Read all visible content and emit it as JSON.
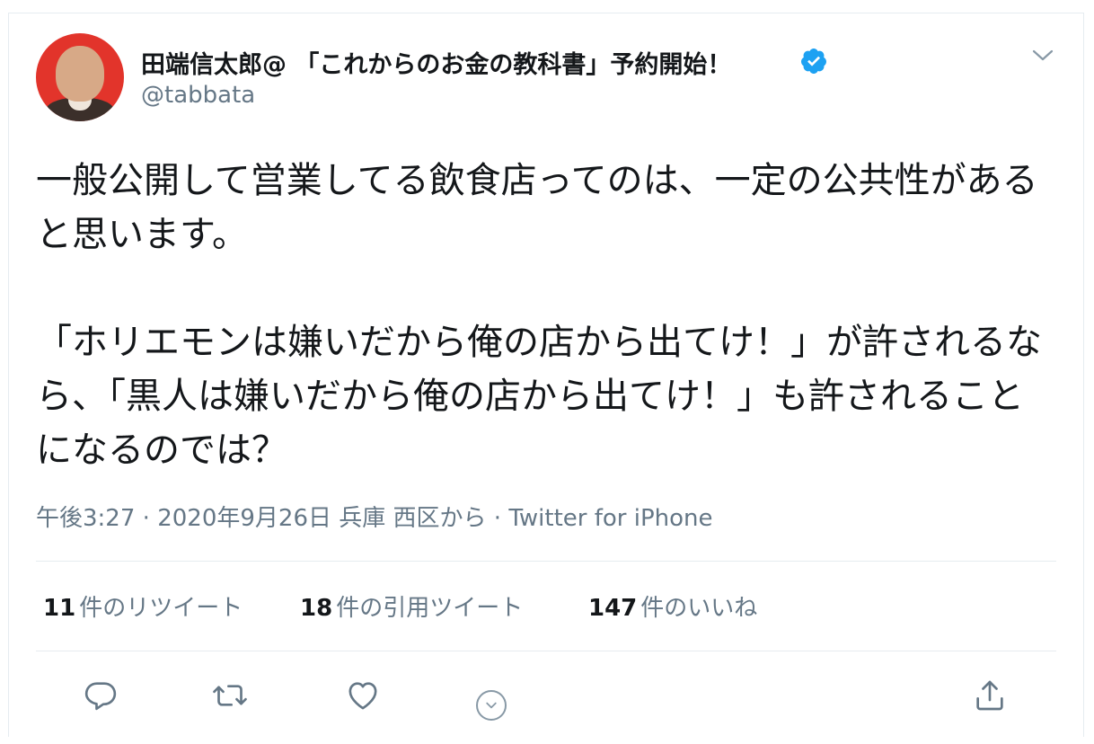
{
  "tweet": {
    "display_name": "田端信太郎@ 「これからのお金の教科書」予約開始！",
    "handle": "@tabbata",
    "text": "一般公開して営業してる飲食店ってのは、一定の公共性があると思います。\n\n「ホリエモンは嫌いだから俺の店から出てけ！」が許されるなら、「黒人は嫌いだから俺の店から出てけ！」も許されることになるのでは？",
    "time": "午後3:27",
    "date": "2020年9月26日",
    "location": "兵庫 西区から",
    "separator": "·",
    "source": "Twitter for iPhone"
  },
  "stats": {
    "retweets_count": "11",
    "retweets_label": "件のリツイート",
    "quotes_count": "18",
    "quotes_label": "件の引用ツイート",
    "likes_count": "147",
    "likes_label": "件のいいね"
  },
  "icons": {
    "verified": "verified-badge-icon",
    "menu": "chevron-down-icon",
    "reply": "reply-icon",
    "retweet": "retweet-icon",
    "like": "heart-icon",
    "share": "share-icon"
  },
  "colors": {
    "text": "#14171a",
    "muted": "#657786",
    "verified": "#1da1f2",
    "divider": "#e6ecf0"
  }
}
